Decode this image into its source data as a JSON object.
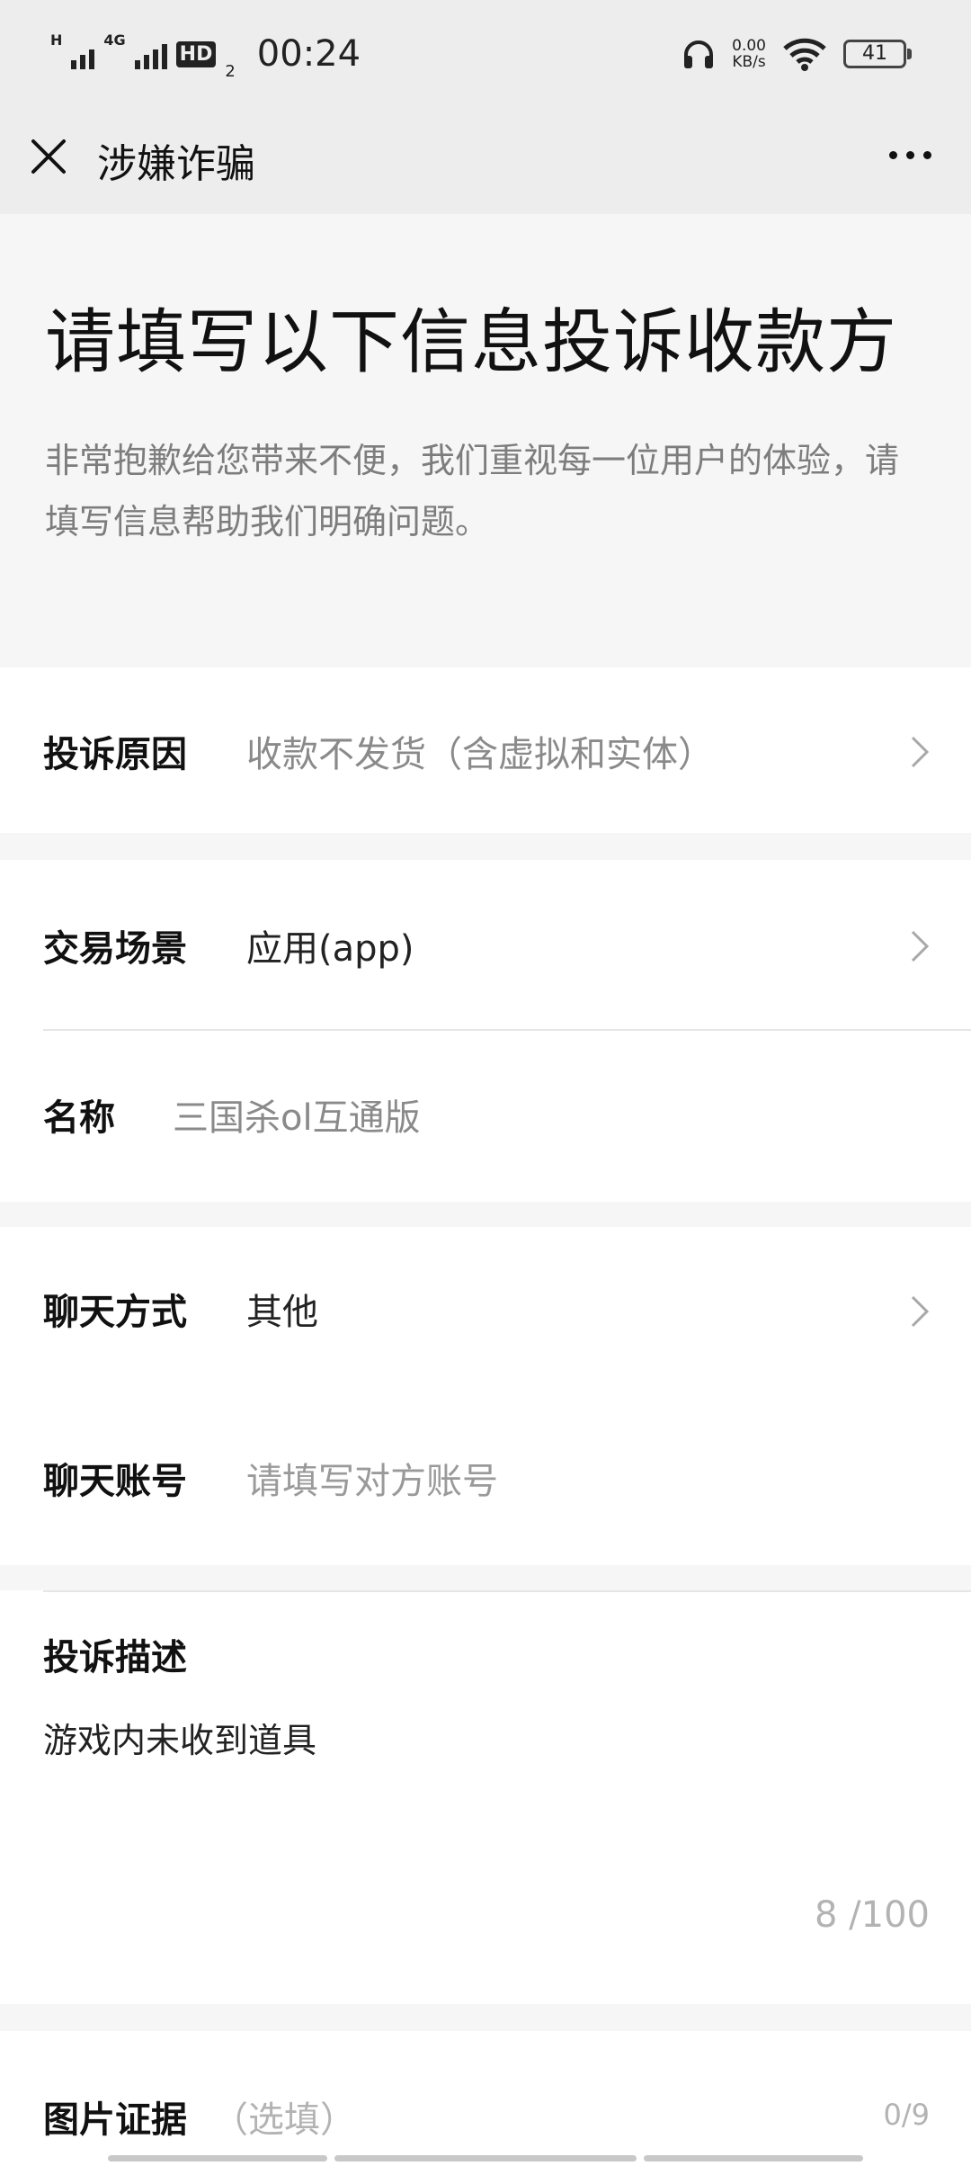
{
  "status_bar": {
    "net_h": "H",
    "net_4g": "4G",
    "hd_badge": "HD",
    "hd_sub": "2",
    "time": "00:24",
    "speed_value": "0.00",
    "speed_unit": "KB/s",
    "battery": "41"
  },
  "nav": {
    "title": "涉嫌诈骗"
  },
  "hero": {
    "title": "请填写以下信息投诉收款方",
    "subtitle": "非常抱歉给您带来不便，我们重视每一位用户的体验，请填写信息帮助我们明确问题。"
  },
  "form": {
    "reason_label": "投诉原因",
    "reason_value": "收款不发货（含虚拟和实体）",
    "scene_label": "交易场景",
    "scene_value": "应用(app)",
    "name_label": "名称",
    "name_value": "三国杀ol互通版",
    "chat_method_label": "聊天方式",
    "chat_method_value": "其他",
    "chat_account_label": "聊天账号",
    "chat_account_placeholder": "请填写对方账号",
    "desc_label": "投诉描述",
    "desc_value": "游戏内未收到道具",
    "desc_counter": "8 /100",
    "evidence_label": "图片证据",
    "evidence_optional": "（选填）",
    "evidence_counter": "0/9"
  }
}
